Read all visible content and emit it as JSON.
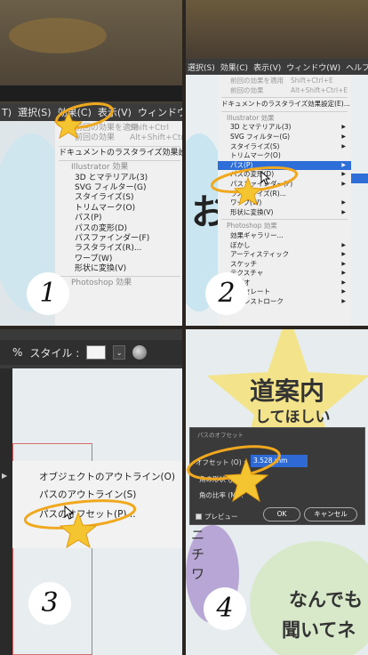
{
  "q1": {
    "menubar": [
      "T)",
      "選択(S)",
      "効果(C)",
      "表示(V)",
      "ウィンドウ("
    ],
    "menu": {
      "prev_apply": "前回の効果を適用",
      "prev_apply_sc": "Shift+Ctrl",
      "prev": "前回の効果",
      "prev_sc": "Alt+Shift+Ctrl",
      "raster_settings": "ドキュメントのラスタライズ効果設定(E)...",
      "section_illustrator": "Illustrator 効果",
      "items": [
        "3D とマテリアル(3)",
        "SVG フィルター(G)",
        "スタイライズ(S)",
        "トリムマーク(O)",
        "パス(P)",
        "パスの変形(D)",
        "パスファインダー(F)",
        "ラスタライズ(R)...",
        "ワープ(W)",
        "形状に変換(V)"
      ],
      "section_photoshop": "Photoshop 効果"
    },
    "step": "1"
  },
  "q2": {
    "menubar": [
      "選択(S)",
      "効果(C)",
      "表示(V)",
      "ウィンドウ(W)",
      "ヘルプ"
    ],
    "menu": {
      "prev_apply": "前回の効果を適用",
      "prev_apply_sc": "Shift+Ctrl+E",
      "prev": "前回の効果",
      "prev_sc": "Alt+Shift+Ctrl+E",
      "raster_settings": "ドキュメントのラスタライズ効果設定(E)...",
      "section_illustrator": "Illustrator 効果",
      "items": [
        "3D とマテリアル(3)",
        "SVG フィルター(G)",
        "スタイライズ(S)",
        "トリムマーク(O)",
        "パス(P)",
        "パスの変形(D)",
        "パスファインダー(F)",
        "ラスタライズ(R)...",
        "ワープ(W)",
        "形状に変換(V)"
      ],
      "section_photoshop": "Photoshop 効果",
      "ps_items": [
        "効果ギャラリー...",
        "ぼかし",
        "アーティスティック",
        "スケッチ",
        "テクスチャ",
        "ビデオ",
        "ピクセレート",
        "ブラシストローク"
      ]
    },
    "canvas_text": "お",
    "step": "2"
  },
  "q3": {
    "toolbar": {
      "zoom": "%",
      "style_label": "スタイル :"
    },
    "menu": [
      "オブジェクトのアウトライン(O)",
      "パスのアウトライン(S)",
      "パスのオフセット(P)..."
    ],
    "step": "3"
  },
  "q4": {
    "title1": "道案内",
    "title2": "してほしい",
    "side_text": "ニ チ ワ",
    "line1": "なんでも",
    "line2": "聞いてネ",
    "dialog": {
      "title": "パスのオフセット",
      "offset_label": "オフセット (O) :",
      "offset_value": "3.528 mm",
      "join_label": "角の形状 (J) :",
      "limit_label": "角の比率 (M) :",
      "preview_label": "プレビュー",
      "ok": "OK",
      "cancel": "キャンセル"
    },
    "step": "4"
  },
  "colors": {
    "highlight": "#2d6ed8",
    "star": "#f5c531",
    "swirl": "#f0a81e"
  },
  "icons": {
    "annotation": "star-swirl-icon",
    "cursor": "mouse-cursor-icon"
  }
}
